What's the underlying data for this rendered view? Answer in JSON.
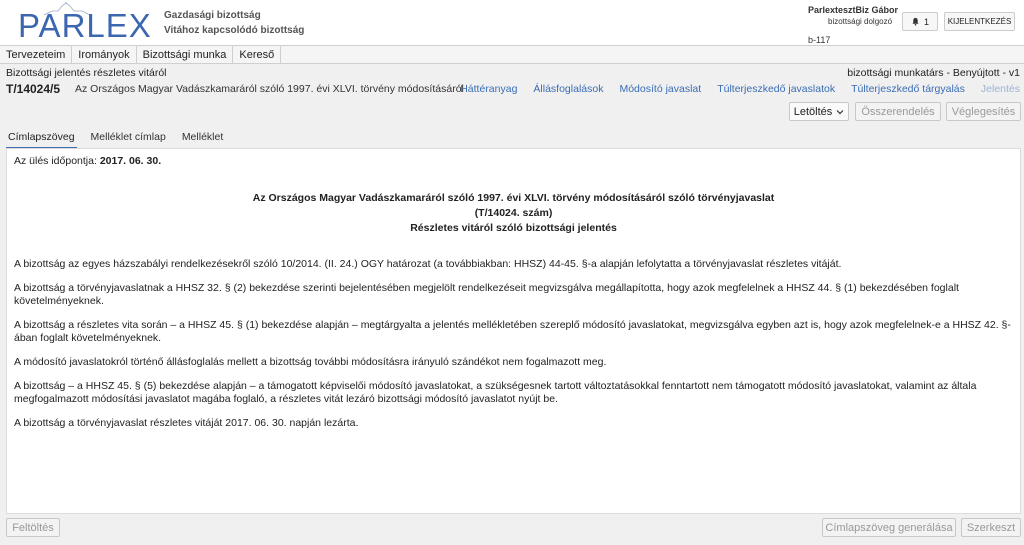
{
  "header": {
    "logo_text": "PARLEX",
    "committee_line1": "Gazdasági bizottság",
    "committee_line2": "Vitához kapcsolódó bizottság",
    "user_name": "ParlextesztBiz Gábor",
    "user_role": "bizottsági dolgozó",
    "user_code": "b-117",
    "notification_count": "1",
    "logout_label": "KIJELENTKEZÉS"
  },
  "menu": {
    "items": [
      "Tervezeteim",
      "Irományok",
      "Bizottsági munka",
      "Kereső"
    ]
  },
  "subheader": {
    "breadcrumb": "Bizottsági jelentés részletes vitáról",
    "status": "bizottsági munkatárs - Benyújtott - v1",
    "doc_id": "T/14024/5",
    "doc_title": "Az Országos Magyar Vadászkamaráról szóló 1997. évi XLVI. törvény módosításáról"
  },
  "nav_links": [
    "Háttéranyag",
    "Állásfoglalások",
    "Módosító javaslat",
    "Túlterjeszkedő javaslatok",
    "Túlterjeszkedő tárgyalás",
    "Jelentés"
  ],
  "actions": {
    "download": "Letöltés",
    "merge": "Összerendelés",
    "finalize": "Véglegesítés"
  },
  "tabs": [
    "Címlapszöveg",
    "Melléklet címlap",
    "Melléklet"
  ],
  "document": {
    "session_label": "Az ülés időpontja:",
    "session_date": "2017. 06. 30.",
    "title_line1": "Az Országos Magyar Vadászkamaráról szóló 1997. évi XLVI. törvény módosításáról szóló törvényjavaslat",
    "title_line2": "(T/14024. szám)",
    "title_line3": "Részletes vitáról szóló bizottsági jelentés",
    "paragraphs": [
      "A bizottság az egyes házszabályi rendelkezésekről szóló 10/2014. (II. 24.) OGY határozat (a továbbiakban: HHSZ) 44-45. §-a alapján lefolytatta a törvényjavaslat részletes vitáját.",
      "A bizottság a törvényjavaslatnak a HHSZ 32. § (2) bekezdése szerinti bejelentésében megjelölt rendelkezéseit megvizsgálva megállapította, hogy azok megfelelnek a HHSZ 44. § (1) bekezdésében foglalt követelményeknek.",
      "A bizottság a részletes vita során – a HHSZ 45. § (1) bekezdése alapján – megtárgyalta a jelentés mellékletében szereplő módosító javaslatokat, megvizsgálva egyben azt is, hogy azok megfelelnek-e a HHSZ 42. §-ában foglalt követelményeknek.",
      "A módosító javaslatokról történő állásfoglalás mellett a bizottság további módosításra irányuló szándékot nem fogalmazott meg.",
      "A bizottság – a HHSZ 45. § (5) bekezdése alapján – a támogatott képviselői módosító javaslatokat, a szükségesnek tartott változtatásokkal fenntartott nem támogatott módosító javaslatokat, valamint az általa megfogalmazott módosítási javaslatot magába foglaló, a részletes vitát lezáró bizottsági módosító javaslatot nyújt be.",
      "A bizottság a törvényjavaslat részletes vitáját 2017. 06. 30. napján lezárta."
    ]
  },
  "footer": {
    "upload": "Feltöltés",
    "generate": "Címlapszöveg generálása",
    "edit": "Szerkeszt"
  },
  "colors": {
    "link": "#3a6db5",
    "logo": "#3c67b0"
  }
}
